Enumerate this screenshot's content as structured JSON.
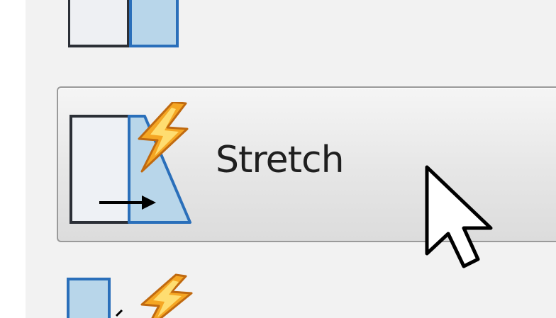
{
  "menu": {
    "faint_label": "",
    "stretch_button": {
      "label": "Stretch",
      "icon": "stretch-lightning-icon"
    },
    "items_partial": [
      {
        "icon": "two-pane-layout-icon",
        "position": "above"
      },
      {
        "icon": "square-lightning-icon",
        "position": "below"
      }
    ]
  },
  "colors": {
    "accent_blue": "#b8d6ea",
    "blue_border": "#2a6fba",
    "lightning": "#f5a623",
    "button_border": "#9a9a9a"
  },
  "cursor": {
    "icon": "arrow-cursor-icon"
  }
}
